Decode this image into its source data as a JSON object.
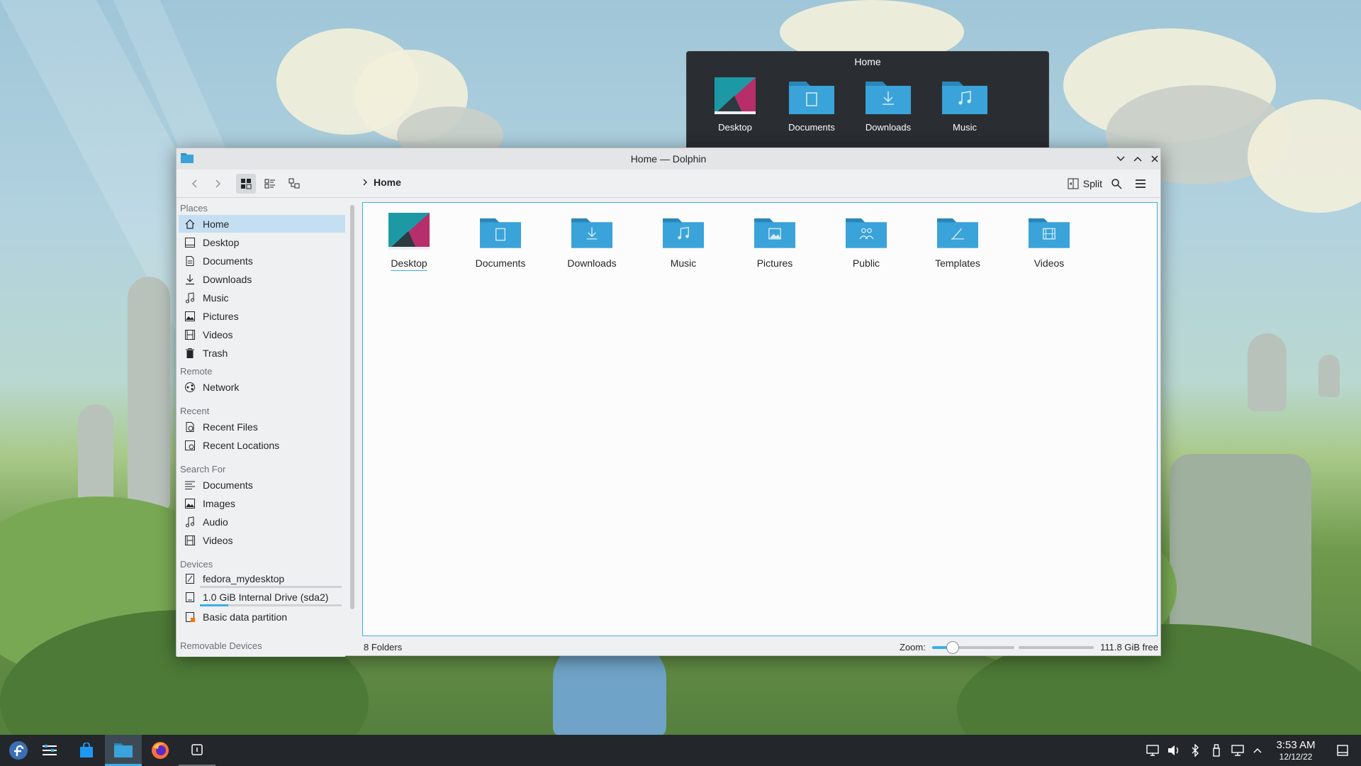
{
  "preview": {
    "title": "Home",
    "items": [
      {
        "label": "Desktop",
        "icon": "desktop-folder-icon"
      },
      {
        "label": "Documents",
        "icon": "documents-folder-icon"
      },
      {
        "label": "Downloads",
        "icon": "downloads-folder-icon"
      },
      {
        "label": "Music",
        "icon": "music-folder-icon"
      }
    ]
  },
  "window": {
    "title": "Home — Dolphin",
    "toolbar": {
      "breadcrumb": "Home",
      "split_label": "Split"
    },
    "sidebar": {
      "sections": {
        "places": "Places",
        "remote": "Remote",
        "recent": "Recent",
        "search_for": "Search For",
        "devices": "Devices",
        "removable": "Removable Devices"
      },
      "places": [
        "Home",
        "Desktop",
        "Documents",
        "Downloads",
        "Music",
        "Pictures",
        "Videos",
        "Trash"
      ],
      "remote": [
        "Network"
      ],
      "recent": [
        "Recent Files",
        "Recent Locations"
      ],
      "search_for": [
        "Documents",
        "Images",
        "Audio",
        "Videos"
      ],
      "devices": [
        {
          "label": "fedora_mydesktop",
          "usage": 0.0
        },
        {
          "label": "1.0 GiB Internal Drive (sda2)",
          "usage": 0.2
        },
        {
          "label": "Basic data partition"
        }
      ]
    },
    "files": [
      "Desktop",
      "Documents",
      "Downloads",
      "Music",
      "Pictures",
      "Public",
      "Templates",
      "Videos"
    ],
    "status": {
      "folders": "8 Folders",
      "zoom_label": "Zoom:",
      "zoom_level": 0.25,
      "free_space": "111.8 GiB free"
    }
  },
  "taskbar": {
    "time": "3:53 AM",
    "date": "12/12/22"
  },
  "colors": {
    "accent": "#3daee9",
    "folder": "#3aa3d9",
    "folder_tab": "#2a86b8",
    "taskbar": "#23272b"
  }
}
